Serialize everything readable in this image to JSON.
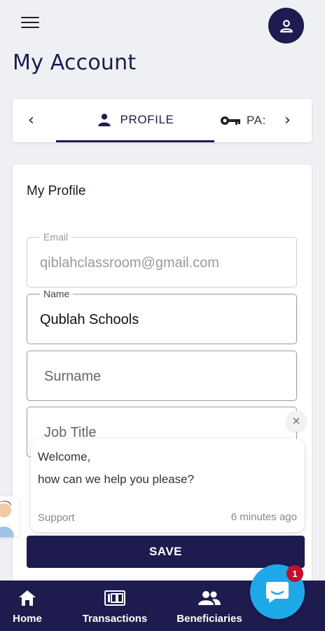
{
  "header": {
    "page_title": "My Account"
  },
  "tabs": {
    "items": [
      {
        "label": "PROFILE",
        "icon": "person-icon",
        "active": true
      },
      {
        "label": "PA:",
        "icon": "key-icon",
        "active": false
      }
    ]
  },
  "profile": {
    "title": "My Profile",
    "fields": {
      "email": {
        "label": "Email",
        "value": "qiblahclassroom@gmail.com",
        "disabled": true
      },
      "name": {
        "label": "Name",
        "value": "Qublah Schools"
      },
      "surname": {
        "placeholder": "Surname"
      },
      "job_title": {
        "placeholder": "Job Title"
      }
    },
    "save_label": "SAVE"
  },
  "chat": {
    "line1": "Welcome,",
    "line2": "how can we help you please?",
    "sender": "Support",
    "time": "6 minutes ago",
    "badge_count": "1"
  },
  "bottom_nav": {
    "items": [
      {
        "label": "Home",
        "icon": "home-icon"
      },
      {
        "label": "Transactions",
        "icon": "receipt-icon"
      },
      {
        "label": "Beneficiaries",
        "icon": "people-icon"
      }
    ]
  },
  "colors": {
    "primary": "#1e1b4e",
    "chat_accent": "#1fa8e8",
    "badge": "#c0102a",
    "background": "#eef0f3"
  }
}
